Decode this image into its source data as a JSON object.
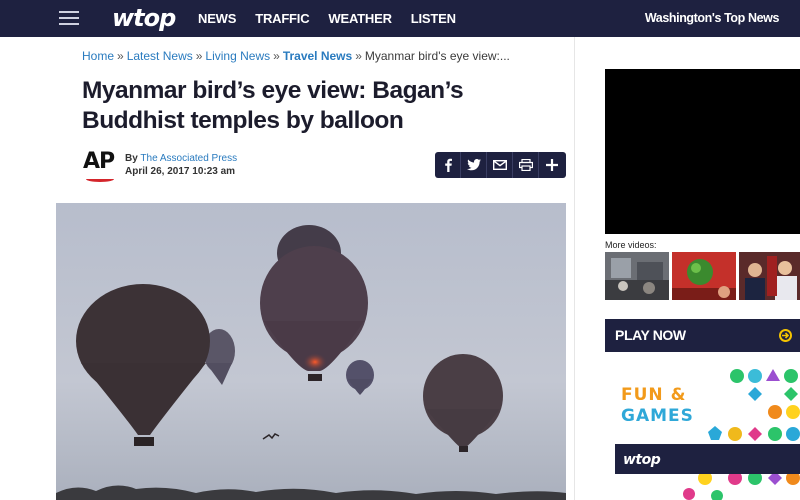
{
  "header": {
    "logo": "wtop",
    "nav": [
      "NEWS",
      "TRAFFIC",
      "WEATHER",
      "LISTEN"
    ],
    "tagline": "Washington's Top News"
  },
  "breadcrumb": {
    "items": [
      "Home",
      "Latest News",
      "Living News",
      "Travel News"
    ],
    "separator": "»",
    "current": "Myanmar bird's eye view:..."
  },
  "article": {
    "title": "Myanmar bird’s eye view: Bagan’s Buddhist temples by balloon",
    "by_label": "By",
    "author": "The Associated Press",
    "date": "April 26, 2017 10:23 am",
    "source_logo": "AP",
    "share_icons": [
      "facebook-icon",
      "twitter-icon",
      "email-icon",
      "print-icon",
      "plus-icon"
    ]
  },
  "sidebar": {
    "more_videos_label": "More videos:",
    "play_now_label": "PLAY NOW",
    "game_title_line1": "FUN &",
    "game_title_line2": "GAMES",
    "game_brand": "wtop"
  },
  "colors": {
    "header_bg": "#1e2140",
    "link": "#2a7bbf",
    "accent_yellow": "#f5c400",
    "ap_red": "#d4252b"
  }
}
